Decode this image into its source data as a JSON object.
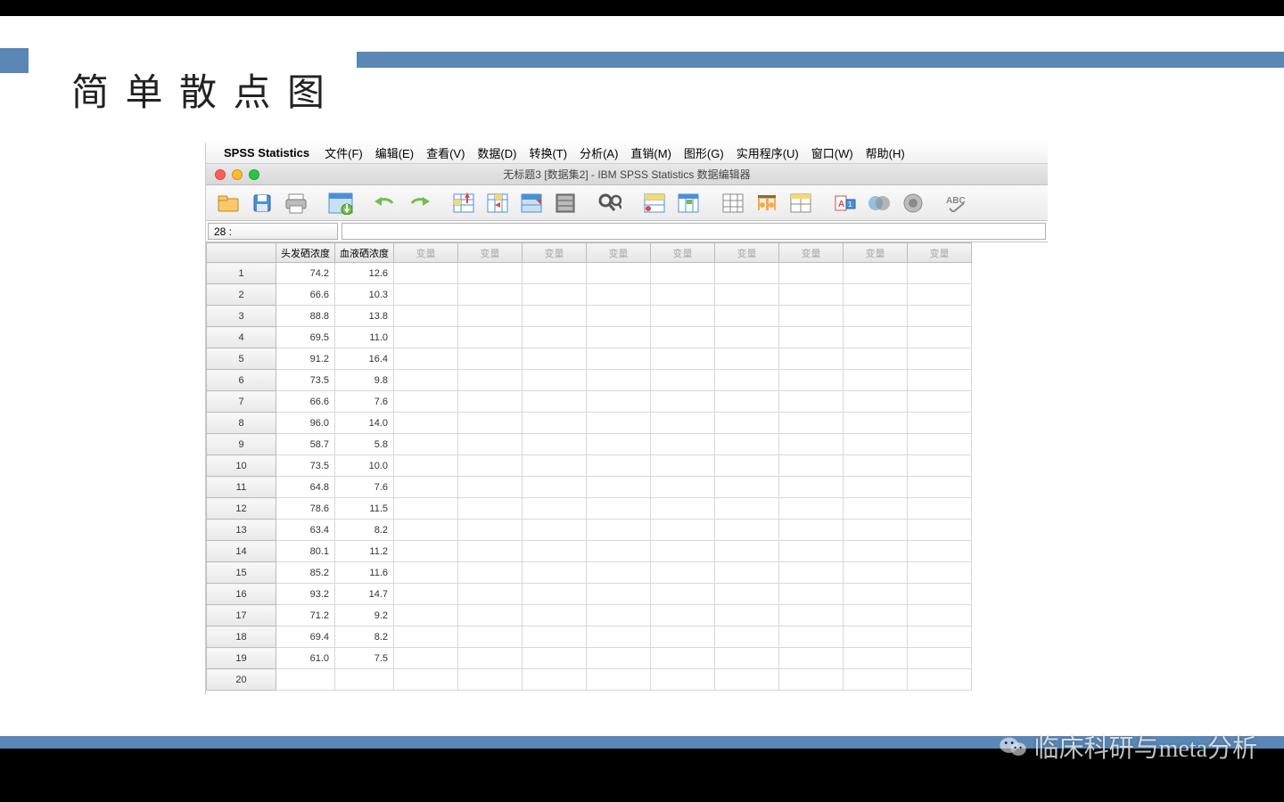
{
  "slide": {
    "title": "简 单 散 点 图"
  },
  "watermark": {
    "text": "临床科研与meta分析"
  },
  "menubar": {
    "app_name": "SPSS Statistics",
    "items": [
      "文件(F)",
      "编辑(E)",
      "查看(V)",
      "数据(D)",
      "转换(T)",
      "分析(A)",
      "直销(M)",
      "图形(G)",
      "实用程序(U)",
      "窗口(W)",
      "帮助(H)"
    ]
  },
  "window": {
    "title": "无标题3 [数据集2] - IBM SPSS Statistics 数据编辑器"
  },
  "cell_ref": "28 :",
  "columns": {
    "data": [
      "头发硒浓度",
      "血液硒浓度"
    ],
    "empty_label": "变量",
    "empty_count": 9
  },
  "rows": [
    {
      "n": 1,
      "v": [
        "74.2",
        "12.6"
      ]
    },
    {
      "n": 2,
      "v": [
        "66.6",
        "10.3"
      ]
    },
    {
      "n": 3,
      "v": [
        "88.8",
        "13.8"
      ]
    },
    {
      "n": 4,
      "v": [
        "69.5",
        "11.0"
      ]
    },
    {
      "n": 5,
      "v": [
        "91.2",
        "16.4"
      ]
    },
    {
      "n": 6,
      "v": [
        "73.5",
        "9.8"
      ]
    },
    {
      "n": 7,
      "v": [
        "66.6",
        "7.6"
      ]
    },
    {
      "n": 8,
      "v": [
        "96.0",
        "14.0"
      ]
    },
    {
      "n": 9,
      "v": [
        "58.7",
        "5.8"
      ]
    },
    {
      "n": 10,
      "v": [
        "73.5",
        "10.0"
      ]
    },
    {
      "n": 11,
      "v": [
        "64.8",
        "7.6"
      ]
    },
    {
      "n": 12,
      "v": [
        "78.6",
        "11.5"
      ]
    },
    {
      "n": 13,
      "v": [
        "63.4",
        "8.2"
      ]
    },
    {
      "n": 14,
      "v": [
        "80.1",
        "11.2"
      ]
    },
    {
      "n": 15,
      "v": [
        "85.2",
        "11.6"
      ]
    },
    {
      "n": 16,
      "v": [
        "93.2",
        "14.7"
      ]
    },
    {
      "n": 17,
      "v": [
        "71.2",
        "9.2"
      ]
    },
    {
      "n": 18,
      "v": [
        "69.4",
        "8.2"
      ]
    },
    {
      "n": 19,
      "v": [
        "61.0",
        "7.5"
      ]
    },
    {
      "n": 20,
      "v": [
        "",
        ""
      ]
    }
  ],
  "toolbar_icons": [
    "open-icon",
    "save-icon",
    "print-icon",
    "sep",
    "recall-dialog-icon",
    "sep",
    "undo-icon",
    "redo-icon",
    "sep",
    "goto-case-icon",
    "goto-var-icon",
    "variables-icon",
    "insert-case-icon",
    "sep",
    "find-icon",
    "sep",
    "split-file-icon",
    "weight-cases-icon",
    "sep",
    "select-cases-icon",
    "value-labels-icon",
    "use-sets-icon",
    "sep",
    "show-all-icon",
    "spell-check-icon",
    "run-icon",
    "sep",
    "abc-icon"
  ]
}
